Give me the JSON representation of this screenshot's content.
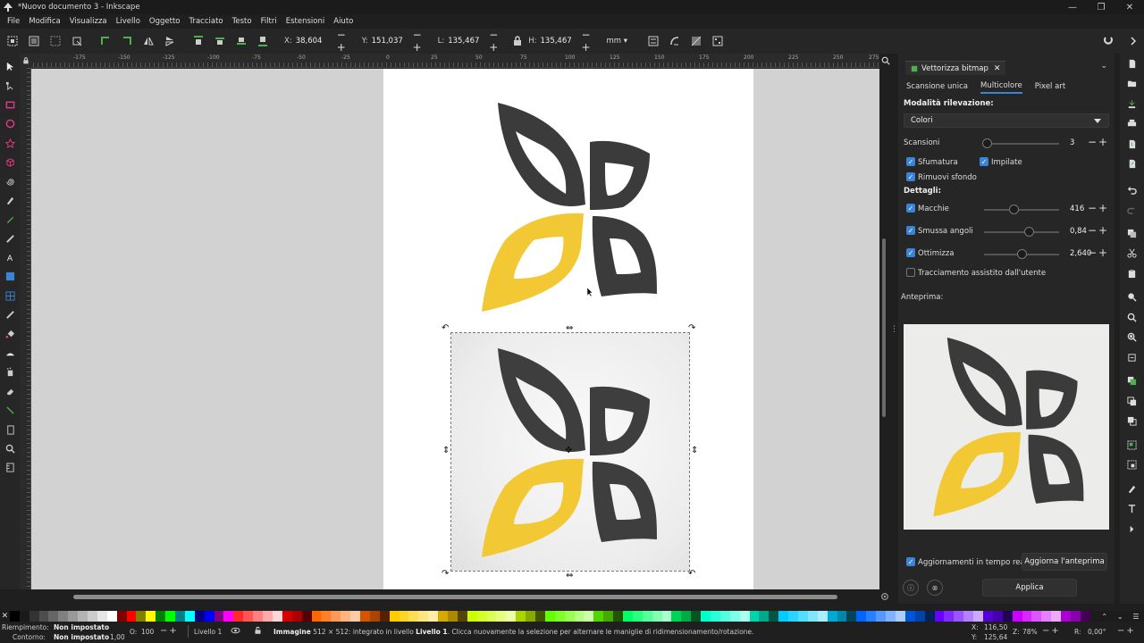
{
  "window": {
    "title": "*Nuovo documento 3 - Inkscape",
    "controls": [
      "—",
      "❐",
      "✕"
    ]
  },
  "menu": [
    "File",
    "Modifica",
    "Visualizza",
    "Livello",
    "Oggetto",
    "Tracciato",
    "Testo",
    "Filtri",
    "Estensioni",
    "Aiuto"
  ],
  "toolbar": {
    "x_label": "X:",
    "x_value": "38,604",
    "y_label": "Y:",
    "y_value": "151,037",
    "w_label": "L:",
    "w_value": "135,467",
    "h_label": "H:",
    "h_value": "135,467",
    "unit": "mm"
  },
  "ruler_ticks": [
    "-175",
    "-150",
    "-125",
    "-100",
    "-75",
    "-50",
    "-25",
    "0",
    "25",
    "50",
    "75",
    "100",
    "125",
    "150",
    "175",
    "200",
    "225",
    "250",
    "275"
  ],
  "panel": {
    "tab": "Vettorizza bitmap",
    "subtabs": [
      "Scansione unica",
      "Multicolore",
      "Pixel art"
    ],
    "mode_title": "Modalità rilevazione:",
    "mode_value": "Colori",
    "scans_label": "Scansioni",
    "scans_value": "3",
    "smooth_label": "Sfumatura",
    "stack_label": "Impilate",
    "remove_bg_label": "Rimuovi sfondo",
    "details_title": "Dettagli:",
    "speckles_label": "Macchie",
    "speckles_value": "416",
    "corners_label": "Smussa angoli",
    "corners_value": "0,84",
    "optimize_label": "Ottimizza",
    "optimize_value": "2,640",
    "assisted_label": "Tracciamento assistito dall'utente",
    "preview_label": "Anteprima:",
    "live_label": "Aggiornamenti in tempo reale",
    "update_btn": "Aggiorna l'anteprima",
    "apply_btn": "Applica",
    "info_icon": "ⓘ",
    "cancel_icon": "⊗"
  },
  "status": {
    "fill_label": "Riempimento:",
    "fill_value": "Non impostato",
    "stroke_label": "Contorno:",
    "stroke_value": "Non impostato",
    "stroke_width": "1,00",
    "opacity_label": "O:",
    "opacity_value": "100",
    "layer": "Livello 1",
    "msg_obj": "Immagine",
    "msg_rest": " 512 × 512: integrato in livello ",
    "msg_layer": "Livello 1",
    "msg_tail": ". Clicca nuovamente la selezione per alternare le maniglie di ridimensionamento/rotazione.",
    "x_label": "X:",
    "x_value": "116,50",
    "y_label": "Y:",
    "y_value": "125,64",
    "zoom_label": "Z:",
    "zoom_value": "78%",
    "rot_label": "R:",
    "rot_value": "0,00°"
  },
  "colors": {
    "yellow": "#f2c935",
    "dark": "#3b3b3b",
    "accent": "#3a84d6",
    "palette": [
      "#000000",
      "#1a1a1a",
      "#333333",
      "#4d4d4d",
      "#666666",
      "#808080",
      "#999999",
      "#b3b3b3",
      "#cccccc",
      "#e6e6e6",
      "#ffffff",
      "#800000",
      "#ff0000",
      "#808000",
      "#ffff00",
      "#008000",
      "#00ff00",
      "#008080",
      "#00ffff",
      "#000080",
      "#0000ff",
      "#800080",
      "#ff00ff",
      "#ff2a2a",
      "#ff5555",
      "#ff8080",
      "#ffaaaa",
      "#ffd5d5",
      "#d40000",
      "#aa0000",
      "#550000",
      "#ff6600",
      "#ff7f2a",
      "#ff9955",
      "#ffb380",
      "#ffccaa",
      "#d45500",
      "#aa4400",
      "#552200",
      "#ffcc00",
      "#ffd42a",
      "#ffdd55",
      "#ffe680",
      "#ffeeaa",
      "#d4aa00",
      "#aa8800",
      "#554400",
      "#ccff00",
      "#d4ff2a",
      "#ddff55",
      "#e5ff80",
      "#eeffaa",
      "#aad400",
      "#88aa00",
      "#445500",
      "#66ff00",
      "#7fff2a",
      "#99ff55",
      "#b3ff80",
      "#ccffaa",
      "#55d400",
      "#44aa00",
      "#225500",
      "#00ff66",
      "#2aff80",
      "#55ff99",
      "#80ffb3",
      "#aaffcc",
      "#00d455",
      "#00aa44",
      "#005522",
      "#00ffcc",
      "#2affd5",
      "#55ffdd",
      "#80ffe6",
      "#aaffee",
      "#00d4aa",
      "#00aa88",
      "#005544",
      "#00ccff",
      "#2ad4ff",
      "#55ddff",
      "#80e5ff",
      "#aaeeff",
      "#00aad4",
      "#0088aa",
      "#004455",
      "#0066ff",
      "#2a7fff",
      "#5599ff",
      "#80b3ff",
      "#aaccff",
      "#0055d4",
      "#0044aa",
      "#002255",
      "#6600ff",
      "#7f2aff",
      "#9955ff",
      "#b380ff",
      "#ccaaff",
      "#5500d4",
      "#4400aa",
      "#220055",
      "#cc00ff",
      "#d42aff",
      "#dd55ff",
      "#e580ff",
      "#eeaaff",
      "#aa00d4",
      "#8800aa",
      "#440055"
    ]
  }
}
